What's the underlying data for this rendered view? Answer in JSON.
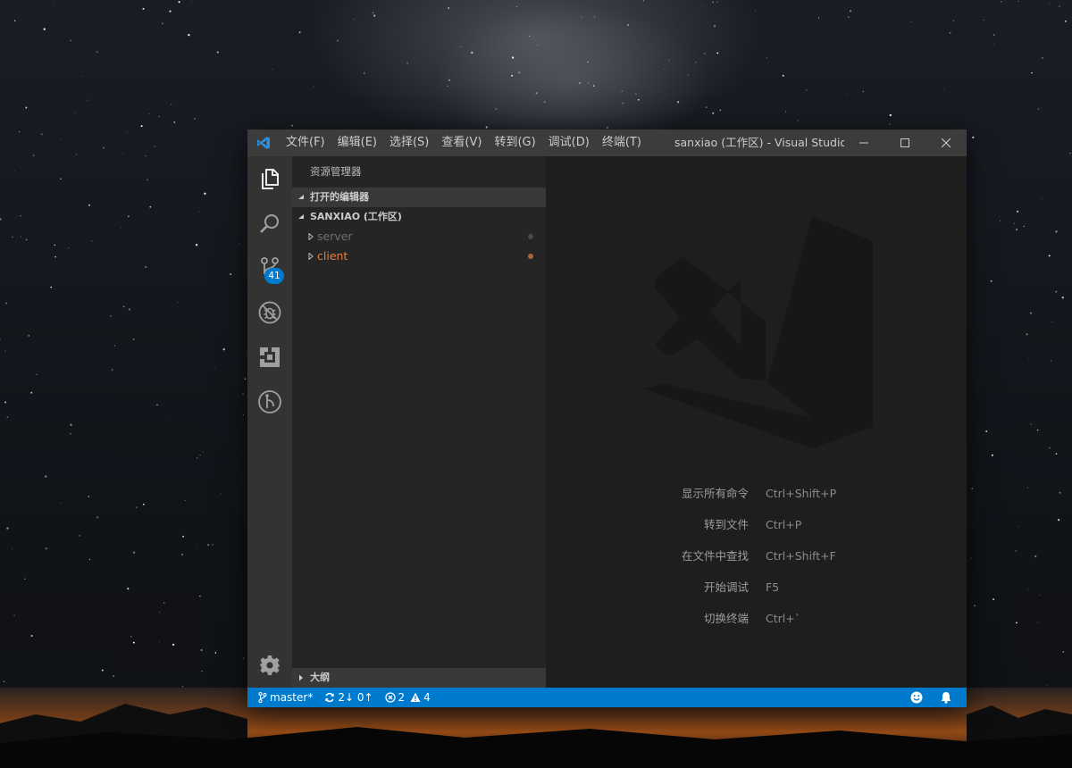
{
  "window": {
    "title": "sanxiao (工作区) - Visual Studio C...",
    "menu": [
      "文件(F)",
      "编辑(E)",
      "选择(S)",
      "查看(V)",
      "转到(G)",
      "调试(D)",
      "终端(T)"
    ]
  },
  "activity_bar": {
    "items": [
      "explorer-icon",
      "search-icon",
      "source-control-icon",
      "debug-icon",
      "extensions-icon",
      "gitlens-icon"
    ],
    "scm_badge": "41",
    "bottom": "gear-icon"
  },
  "sidebar": {
    "title": "资源管理器",
    "open_editors": "打开的编辑器",
    "workspace": "SANXIAO (工作区)",
    "folders": [
      {
        "name": "server",
        "color": "#6f6f6f",
        "dot": "#4a4a4a"
      },
      {
        "name": "client",
        "color": "#e2803d",
        "dot": "#a8663a"
      }
    ],
    "outline": "大纲"
  },
  "editor": {
    "shortcuts": [
      {
        "label": "显示所有命令",
        "keys": "Ctrl+Shift+P"
      },
      {
        "label": "转到文件",
        "keys": "Ctrl+P"
      },
      {
        "label": "在文件中查找",
        "keys": "Ctrl+Shift+F"
      },
      {
        "label": "开始调试",
        "keys": "F5"
      },
      {
        "label": "切换终端",
        "keys": "Ctrl+`"
      }
    ]
  },
  "status_bar": {
    "branch": "master*",
    "sync": "2↓ 0↑",
    "errors": "2",
    "warnings": "4"
  },
  "colors": {
    "accent": "#007acc",
    "titlebar": "#3c3c3c",
    "activity_bar": "#333333",
    "sidebar": "#252526",
    "editor": "#1e1e1e"
  }
}
